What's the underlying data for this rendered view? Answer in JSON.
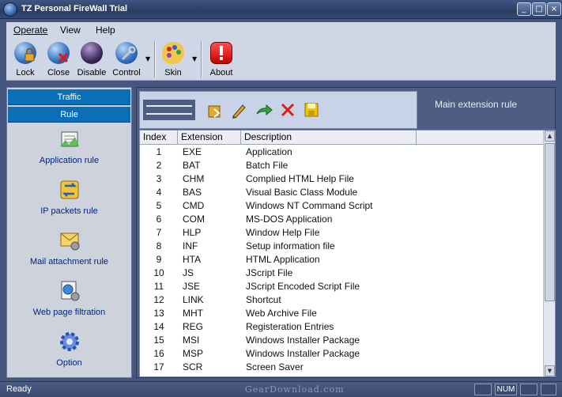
{
  "window": {
    "title": "TZ Personal FireWall Trial",
    "controls": {
      "minimize": "_",
      "maximize": "□",
      "close": "×"
    }
  },
  "menu": {
    "items": [
      {
        "label": "Operate",
        "icon": ""
      },
      {
        "label": "View"
      },
      {
        "label": "Help"
      }
    ]
  },
  "toolbar": {
    "buttons": [
      {
        "label": "Lock",
        "icon": "lock-globe-icon"
      },
      {
        "label": "Close",
        "icon": "close-globe-icon"
      },
      {
        "label": "Disable",
        "icon": "disable-orb-icon"
      },
      {
        "label": "Control",
        "icon": "control-globe-icon"
      },
      {
        "label": "Skin",
        "icon": "palette-icon"
      },
      {
        "label": "About",
        "icon": "about-alert-icon"
      }
    ],
    "dropdown_arrow": "▼"
  },
  "sidebar": {
    "tabs": [
      "Traffic",
      "Rule"
    ],
    "items": [
      {
        "label": "Application rule",
        "icon": "application-rule-icon"
      },
      {
        "label": "IP packets rule",
        "icon": "ip-packets-icon"
      },
      {
        "label": "Mail attachment rule",
        "icon": "mail-attachment-icon"
      },
      {
        "label": "Web page filtration",
        "icon": "web-filter-icon"
      },
      {
        "label": "Option",
        "icon": "gear-icon"
      }
    ]
  },
  "content": {
    "title": "Main extension rule",
    "toolbar_icons": [
      "open-icon",
      "edit-icon",
      "forward-icon",
      "delete-icon",
      "save-icon"
    ],
    "columns": [
      "Index",
      "Extension",
      "Description"
    ],
    "rows": [
      {
        "index": "1",
        "ext": "EXE",
        "desc": "Application"
      },
      {
        "index": "2",
        "ext": "BAT",
        "desc": "Batch File"
      },
      {
        "index": "3",
        "ext": "CHM",
        "desc": "Complied HTML Help File"
      },
      {
        "index": "4",
        "ext": "BAS",
        "desc": "Visual Basic Class Module"
      },
      {
        "index": "5",
        "ext": "CMD",
        "desc": "Windows NT Command Script"
      },
      {
        "index": "6",
        "ext": "COM",
        "desc": "MS-DOS Application"
      },
      {
        "index": "7",
        "ext": "HLP",
        "desc": "Window Help File"
      },
      {
        "index": "8",
        "ext": "INF",
        "desc": "Setup information file"
      },
      {
        "index": "9",
        "ext": "HTA",
        "desc": "HTML Application"
      },
      {
        "index": "10",
        "ext": "JS",
        "desc": "JScript File"
      },
      {
        "index": "11",
        "ext": "JSE",
        "desc": "JScript Encoded Script File"
      },
      {
        "index": "12",
        "ext": "LINK",
        "desc": "Shortcut"
      },
      {
        "index": "13",
        "ext": "MHT",
        "desc": "Web Archive File"
      },
      {
        "index": "14",
        "ext": "REG",
        "desc": "Registeration Entries"
      },
      {
        "index": "15",
        "ext": "MSI",
        "desc": "Windows Installer Package"
      },
      {
        "index": "16",
        "ext": "MSP",
        "desc": "Windows Installer Package"
      },
      {
        "index": "17",
        "ext": "SCR",
        "desc": "Screen Saver"
      }
    ],
    "scroll_up": "▲",
    "scroll_down": "▼"
  },
  "status": {
    "text": "Ready",
    "watermark": "GearDownload.com",
    "num": "NUM"
  },
  "colors": {
    "frame": "#46577f",
    "accent": "#0a6fb8",
    "sidebar_link": "#00267f"
  }
}
